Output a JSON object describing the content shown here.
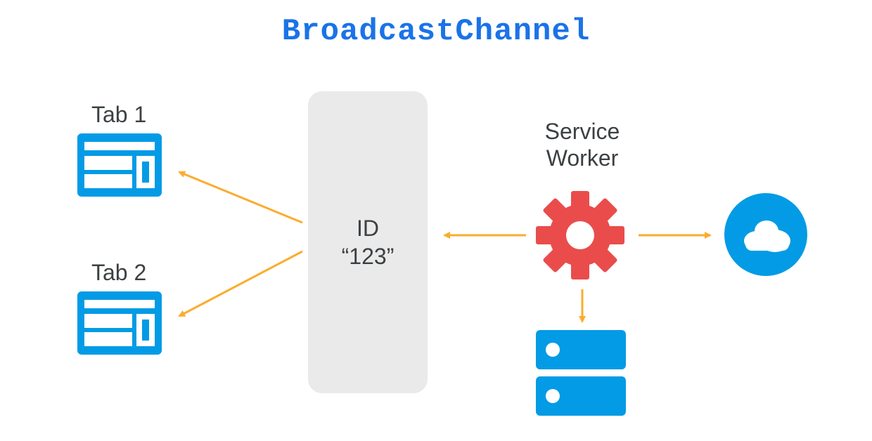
{
  "title": "BroadcastChannel",
  "tabs": [
    {
      "label": "Tab 1"
    },
    {
      "label": "Tab 2"
    }
  ],
  "channel": {
    "id_line1": "ID",
    "id_line2": "“123”"
  },
  "service_worker": {
    "line1": "Service",
    "line2": "Worker"
  },
  "colors": {
    "accent_blue": "#039be5",
    "title_blue": "#1a73e8",
    "arrow_orange": "#fbac2e",
    "gear_red": "#ea4c4c",
    "box_grey": "#eaeaea",
    "text": "#3c4043"
  },
  "icons": {
    "tab": "browser-tab-icon",
    "gear": "gear-icon",
    "cloud": "cloud-icon",
    "storage": "storage-icon"
  }
}
